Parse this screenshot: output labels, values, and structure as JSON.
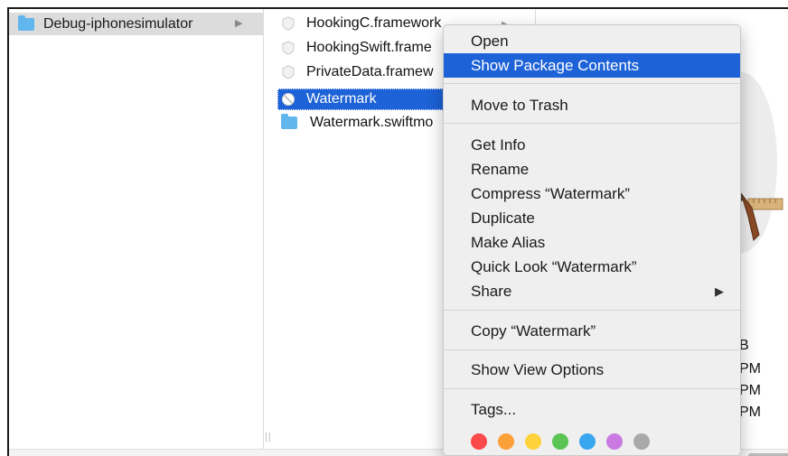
{
  "sidebar": {
    "selected_item": "Debug-iphonesimulator"
  },
  "files": [
    {
      "name": "HookingC.framework",
      "icon": "framework-icon"
    },
    {
      "name": "HookingSwift.frame",
      "icon": "framework-icon"
    },
    {
      "name": "PrivateData.framew",
      "icon": "framework-icon"
    },
    {
      "name": "Watermark",
      "icon": "app-icon",
      "selected": true
    },
    {
      "name": "Watermark.swiftmo",
      "icon": "folder-icon"
    }
  ],
  "preview_meta": {
    "size_suffix": "B",
    "date_suffix_1": "PM",
    "date_suffix_2": "PM",
    "date_suffix_3": "PM"
  },
  "context_menu": {
    "open": "Open",
    "show_package_contents": "Show Package Contents",
    "move_to_trash": "Move to Trash",
    "get_info": "Get Info",
    "rename": "Rename",
    "compress": "Compress “Watermark”",
    "duplicate": "Duplicate",
    "make_alias": "Make Alias",
    "quick_look": "Quick Look “Watermark”",
    "share": "Share",
    "copy": "Copy “Watermark”",
    "show_view_options": "Show View Options",
    "tags": "Tags...",
    "tag_colors": [
      "#fc4a4a",
      "#fca13a",
      "#fdd23a",
      "#5ac555",
      "#39a6f0",
      "#c97ae2",
      "#a9a9a9"
    ]
  },
  "colors": {
    "selection": "#1d62d6",
    "folder": "#62b6ee"
  }
}
